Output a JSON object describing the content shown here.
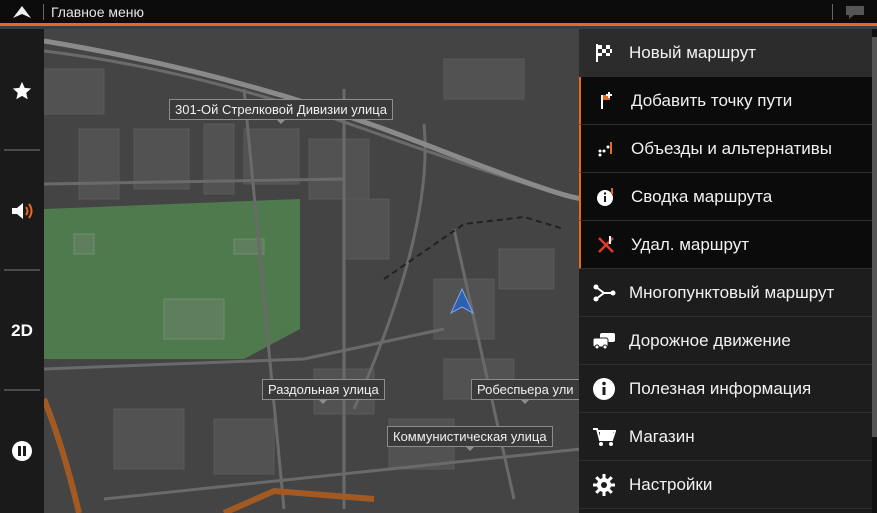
{
  "topbar": {
    "title": "Главное меню",
    "up_icon": "up-arrow-icon",
    "message_icon": "message-bubble-icon"
  },
  "sidebar": {
    "buttons": [
      {
        "name": "favorites",
        "icon": "star-icon"
      },
      {
        "name": "sound",
        "icon": "speaker-icon"
      },
      {
        "name": "view-mode",
        "label": "2D"
      },
      {
        "name": "pause",
        "icon": "pause-icon"
      }
    ]
  },
  "map": {
    "streets": [
      "301-Ой Стрелковой Дивизии улица",
      "Раздольная улица",
      "Робеспьера ули",
      "Коммунистическая улица"
    ]
  },
  "menu": {
    "items": [
      {
        "label": "Новый маршрут",
        "icon": "checkered-flag-icon"
      },
      {
        "label": "Добавить точку пути",
        "icon": "add-waypoint-icon"
      },
      {
        "label": "Объезды и альтернативы",
        "icon": "detour-icon"
      },
      {
        "label": "Сводка маршрута",
        "icon": "route-info-icon"
      },
      {
        "label": "Удал. маршрут",
        "icon": "delete-route-icon"
      },
      {
        "label": "Многопунктовый маршрут",
        "icon": "multipoint-route-icon"
      },
      {
        "label": "Дорожное движение",
        "icon": "traffic-icon"
      },
      {
        "label": "Полезная информация",
        "icon": "info-icon"
      },
      {
        "label": "Магазин",
        "icon": "cart-icon"
      },
      {
        "label": "Настройки",
        "icon": "gear-icon"
      }
    ]
  },
  "colors": {
    "accent": "#e8681e",
    "park": "#4e7a4e",
    "map_background": "#444444"
  }
}
